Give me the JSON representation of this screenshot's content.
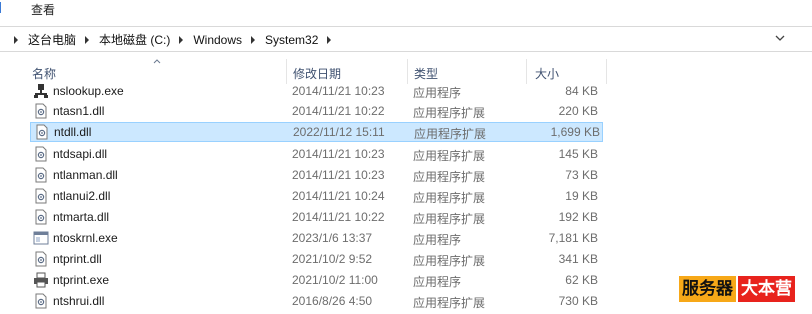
{
  "menubar": {
    "view_label": "查看"
  },
  "address": {
    "crumbs": [
      "这台电脑",
      "本地磁盘 (C:)",
      "Windows",
      "System32"
    ]
  },
  "columns": {
    "name": "名称",
    "date": "修改日期",
    "type": "类型",
    "size": "大小"
  },
  "files": [
    {
      "name": "nslookup.exe",
      "date": "2014/11/21 10:23",
      "type": "应用程序",
      "size": "84 KB",
      "icon": "network-exe-icon"
    },
    {
      "name": "ntasn1.dll",
      "date": "2014/11/21 10:22",
      "type": "应用程序扩展",
      "size": "220 KB",
      "icon": "dll-file-icon"
    },
    {
      "name": "ntdll.dll",
      "date": "2022/11/12 15:11",
      "type": "应用程序扩展",
      "size": "1,699 KB",
      "icon": "dll-file-icon",
      "selected": true
    },
    {
      "name": "ntdsapi.dll",
      "date": "2014/11/21 10:23",
      "type": "应用程序扩展",
      "size": "145 KB",
      "icon": "dll-file-icon"
    },
    {
      "name": "ntlanman.dll",
      "date": "2014/11/21 10:23",
      "type": "应用程序扩展",
      "size": "73 KB",
      "icon": "dll-file-icon"
    },
    {
      "name": "ntlanui2.dll",
      "date": "2014/11/21 10:24",
      "type": "应用程序扩展",
      "size": "19 KB",
      "icon": "dll-file-icon"
    },
    {
      "name": "ntmarta.dll",
      "date": "2014/11/21 10:22",
      "type": "应用程序扩展",
      "size": "192 KB",
      "icon": "dll-file-icon"
    },
    {
      "name": "ntoskrnl.exe",
      "date": "2023/1/6 13:37",
      "type": "应用程序",
      "size": "7,181 KB",
      "icon": "exe-window-icon"
    },
    {
      "name": "ntprint.dll",
      "date": "2021/10/2 9:52",
      "type": "应用程序扩展",
      "size": "341 KB",
      "icon": "dll-file-icon"
    },
    {
      "name": "ntprint.exe",
      "date": "2021/10/2 11:00",
      "type": "应用程序",
      "size": "62 KB",
      "icon": "printer-icon"
    },
    {
      "name": "ntshrui.dll",
      "date": "2016/8/26 4:50",
      "type": "应用程序扩展",
      "size": "730 KB",
      "icon": "dll-file-icon"
    }
  ],
  "watermark": {
    "part1": "服务器",
    "part2": "大本营"
  },
  "colors": {
    "selection_bg": "#cce8ff",
    "selection_border": "#99d1ff",
    "header_text": "#3f5170"
  }
}
